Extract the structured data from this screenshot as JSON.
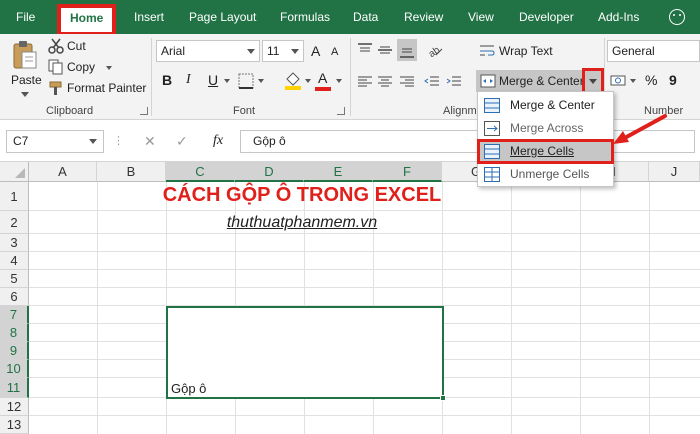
{
  "tabs": [
    {
      "label": "File"
    },
    {
      "label": "Home"
    },
    {
      "label": "Insert"
    },
    {
      "label": "Page Layout"
    },
    {
      "label": "Formulas"
    },
    {
      "label": "Data"
    },
    {
      "label": "Review"
    },
    {
      "label": "View"
    },
    {
      "label": "Developer"
    },
    {
      "label": "Add-Ins"
    }
  ],
  "ribbon": {
    "clipboard": {
      "paste": "Paste",
      "cut": "Cut",
      "copy": "Copy",
      "format_painter": "Format Painter",
      "label": "Clipboard"
    },
    "font": {
      "name": "Arial",
      "size": "11",
      "label": "Font",
      "bold": "B",
      "italic": "I",
      "underline": "U",
      "grow": "A",
      "shrink": "A",
      "fill_letter": "A"
    },
    "alignment": {
      "wrap_text": "Wrap Text",
      "merge_center": "Merge & Center",
      "label": "Alignm"
    },
    "number": {
      "format": "General",
      "percent": "%",
      "comma": "9",
      "label": "Number"
    }
  },
  "merge_menu": {
    "items": [
      {
        "label": "Merge & Center",
        "underline_char": "C"
      },
      {
        "label": "Merge Across",
        "underline_char": "A"
      },
      {
        "label": "Merge Cells",
        "underline_char": "M"
      },
      {
        "label": "Unmerge Cells",
        "underline_char": "U"
      }
    ]
  },
  "formula_bar": {
    "name_box": "C7",
    "cancel": "✕",
    "confirm": "✓",
    "fx": "fx",
    "content": "Gộp ô"
  },
  "sheet": {
    "columns": [
      "A",
      "B",
      "C",
      "D",
      "E",
      "F",
      "G",
      "H",
      "I",
      "J"
    ],
    "rows": [
      "1",
      "2",
      "3",
      "4",
      "5",
      "6",
      "7",
      "8",
      "9",
      "10",
      "11",
      "12",
      "13"
    ],
    "title": "CÁCH GỘP Ô TRONG EXCEL",
    "site": "thuthuatphanmem.vn",
    "merged_value": "Gộp ô"
  },
  "colors": {
    "excel_green": "#217346",
    "highlight_red": "#e0201b",
    "title_red": "#e0201b"
  }
}
